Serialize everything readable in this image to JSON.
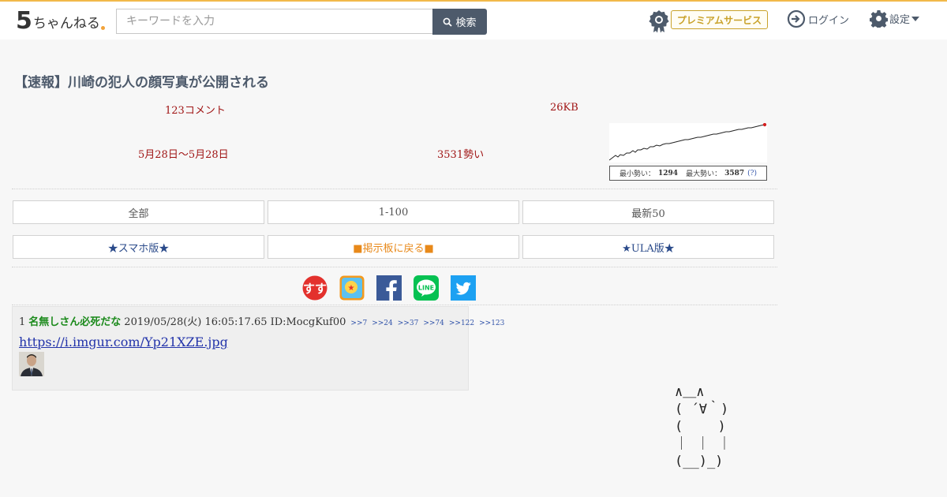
{
  "header": {
    "logo_mark": "5",
    "logo_text": "ちゃんねる",
    "search_placeholder": "キーワードを入力",
    "search_button": "検索",
    "premium": "プレミアムサービス",
    "login": "ログイン",
    "settings": "設定",
    "accent_color": "#f2b94a"
  },
  "thread": {
    "title": "【速報】川崎の犯人の顔写真が公開される",
    "comments": "123コメント",
    "size": "26KB",
    "period": "5月28日〜5月28日",
    "momentum": "3531勢い",
    "chart_min_label": "最小勢い：",
    "chart_min_value": "1294",
    "chart_max_label": "最大勢い：",
    "chart_max_value": "3587",
    "chart_help": "(?)"
  },
  "nav": {
    "all": "全部",
    "range": "1-100",
    "latest": "最新50",
    "smartphone": "★スマホ版★",
    "back_to_board": "■掲示板に戻る■",
    "ula": "★ULA版★"
  },
  "share": [
    "sss-icon",
    "bookmark-icon",
    "facebook-icon",
    "line-icon",
    "twitter-icon"
  ],
  "post": {
    "number": "1",
    "name": "名無しさん必死だな",
    "date": "2019/05/28(火) 16:05:17.65",
    "id": "ID:MocgKuf00",
    "replies": [
      ">>7",
      ">>24",
      ">>37",
      ">>74",
      ">>122",
      ">>123"
    ],
    "link": "https://i.imgur.com/Yp21XZE.jpg"
  },
  "ascii_art": "∧＿∧\n( ´∀｀)\n(　　 )\n｜ ｜ ｜\n(__)_)"
}
